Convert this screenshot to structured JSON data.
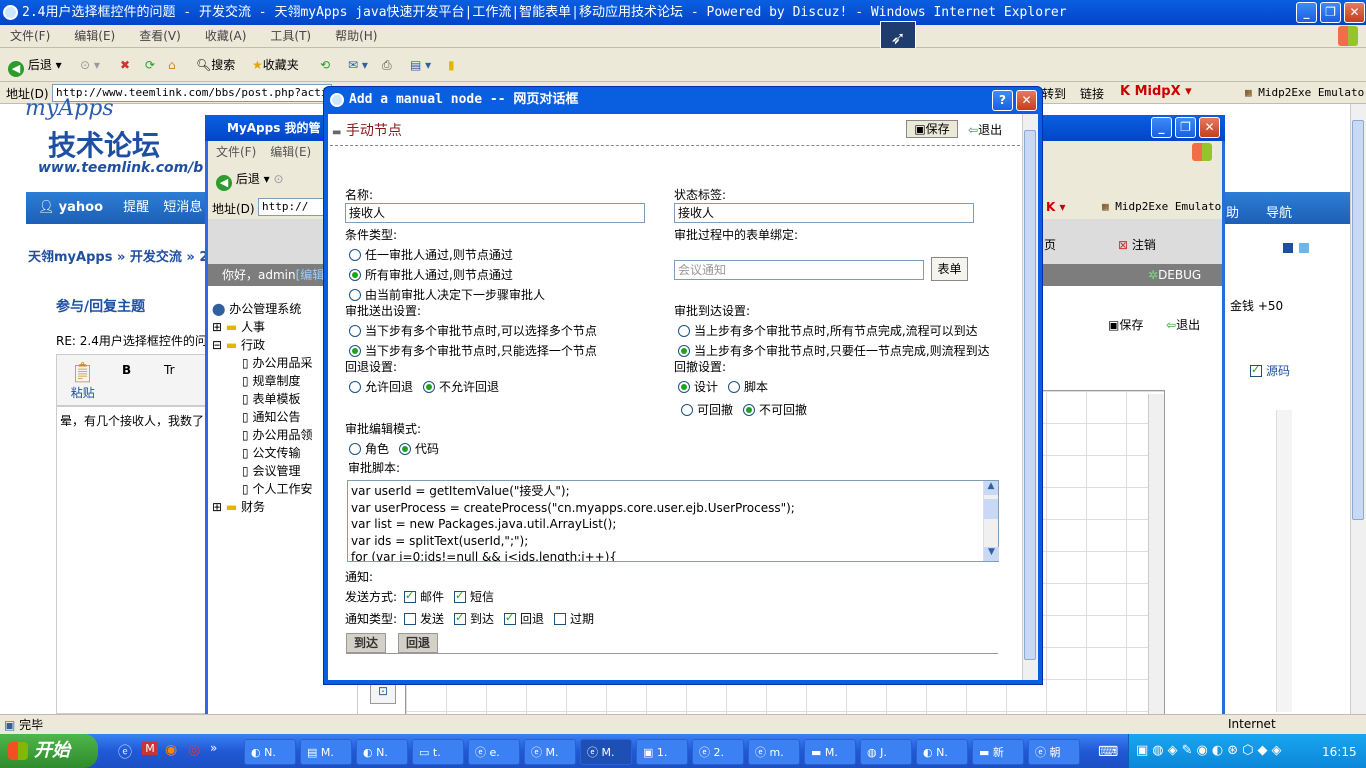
{
  "ie": {
    "title": "2.4用户选择框控件的问题 - 开发交流 - 天翎myApps java快速开发平台|工作流|智能表单|移动应用技术论坛 - Powered by Discuz! - Windows Internet Explorer",
    "menu": [
      "文件(F)",
      "编辑(E)",
      "查看(V)",
      "收藏(A)",
      "工具(T)",
      "帮助(H)"
    ],
    "toolbar": {
      "back": "后退",
      "search": "搜索",
      "favorites": "收藏夹"
    },
    "address_label": "地址(D)",
    "address": "http://www.teemlink.com/bbs/post.php?acti",
    "links": [
      "转到",
      "链接"
    ],
    "plugin": "Midp2Exe Emulato",
    "status": "完毕",
    "zone": "Internet"
  },
  "forum": {
    "logo_top": "myApps",
    "logo_main": "技术论坛",
    "logo_url": "www.teemlink.com/b",
    "nav_user": "yahoo",
    "nav_items": [
      "提醒",
      "短消息"
    ],
    "nav_right": [
      "助",
      "导航"
    ],
    "breadcrumb": [
      "天翎myApps",
      "开发交流",
      "2"
    ],
    "post_title": "参与/回复主题",
    "reply_subject": "RE: 2.4用户选择框控件的问",
    "editor_paste": "粘贴",
    "reply_text": "晕，有几个接收人，我数了",
    "money": "金钱 +50",
    "source_label": "源码"
  },
  "inner": {
    "title": "MyApps 我的管",
    "menu": [
      "文件(F)",
      "编辑(E)"
    ],
    "back": "后退",
    "address_label": "地址(D)",
    "address": "http://",
    "plugin": "Midp2Exe Emulato",
    "right_links": [
      "页",
      "注销"
    ],
    "greeting": "你好，admin",
    "edit_link": "[编辑]",
    "debug": "DEBUG",
    "save": "保存",
    "exit": "退出",
    "tree": [
      {
        "label": "办公管理系统",
        "level": 0
      },
      {
        "label": "人事",
        "level": 1
      },
      {
        "label": "行政",
        "level": 1
      },
      {
        "label": "办公用品采",
        "level": 2
      },
      {
        "label": "规章制度",
        "level": 2
      },
      {
        "label": "表单模板",
        "level": 2
      },
      {
        "label": "通知公告",
        "level": 2
      },
      {
        "label": "办公用品领",
        "level": 2
      },
      {
        "label": "公文传输",
        "level": 2
      },
      {
        "label": "会议管理",
        "level": 2
      },
      {
        "label": "个人工作安",
        "level": 2
      },
      {
        "label": "财务",
        "level": 1
      }
    ]
  },
  "dialog": {
    "title": "Add a manual node -- 网页对话框",
    "header": "手动节点",
    "save": "保存",
    "exit": "退出",
    "name_label": "名称:",
    "name_value": "接收人",
    "state_label": "状态标签:",
    "state_value": "接收人",
    "cond_label": "条件类型:",
    "cond_options": [
      "任一审批人通过,则节点通过",
      "所有审批人通过,则节点通过",
      "由当前审批人决定下一步骤审批人"
    ],
    "form_bind_label": "审批过程中的表单绑定:",
    "form_bind_placeholder": "会议通知",
    "form_button": "表单",
    "send_label": "审批送出设置:",
    "send_options": [
      "当下步有多个审批节点时,可以选择多个节点",
      "当下步有多个审批节点时,只能选择一个节点"
    ],
    "arrive_label": "审批到达设置:",
    "arrive_options": [
      "当上步有多个审批节点时,所有节点完成,流程可以到达",
      "当上步有多个审批节点时,只要任一节点完成,则流程到达"
    ],
    "back_label": "回退设置:",
    "back_options": [
      "允许回退",
      "不允许回退"
    ],
    "retract_label": "回撤设置:",
    "retract_mode_options": [
      "设计",
      "脚本"
    ],
    "retract_options": [
      "可回撤",
      "不可回撤"
    ],
    "edit_mode_label": "审批编辑模式:",
    "edit_mode_options": [
      "角色",
      "代码"
    ],
    "script_label": "审批脚本:",
    "script_lines": [
      "var userId = getItemValue(\"接受人\");",
      "var userProcess = createProcess(\"cn.myapps.core.user.ejb.UserProcess\");",
      "var list = new Packages.java.util.ArrayList();",
      "var ids = splitText(userId,\";\");",
      "for (var i=0;ids!=null && i<ids.length;i++){"
    ],
    "notify_label": "通知:",
    "send_method_label": "发送方式:",
    "send_methods": [
      "邮件",
      "短信"
    ],
    "notify_type_label": "通知类型:",
    "notify_types": [
      "发送",
      "到达",
      "回退",
      "过期"
    ],
    "tabs": [
      "到达",
      "回退"
    ]
  },
  "taskbar": {
    "start": "开始",
    "tasks": [
      "N.",
      "M.",
      "N.",
      "t.",
      "e.",
      "M.",
      "M.",
      "1.",
      "2.",
      "m.",
      "M.",
      "J.",
      "N.",
      "新",
      "朝"
    ],
    "clock": "16:15"
  }
}
